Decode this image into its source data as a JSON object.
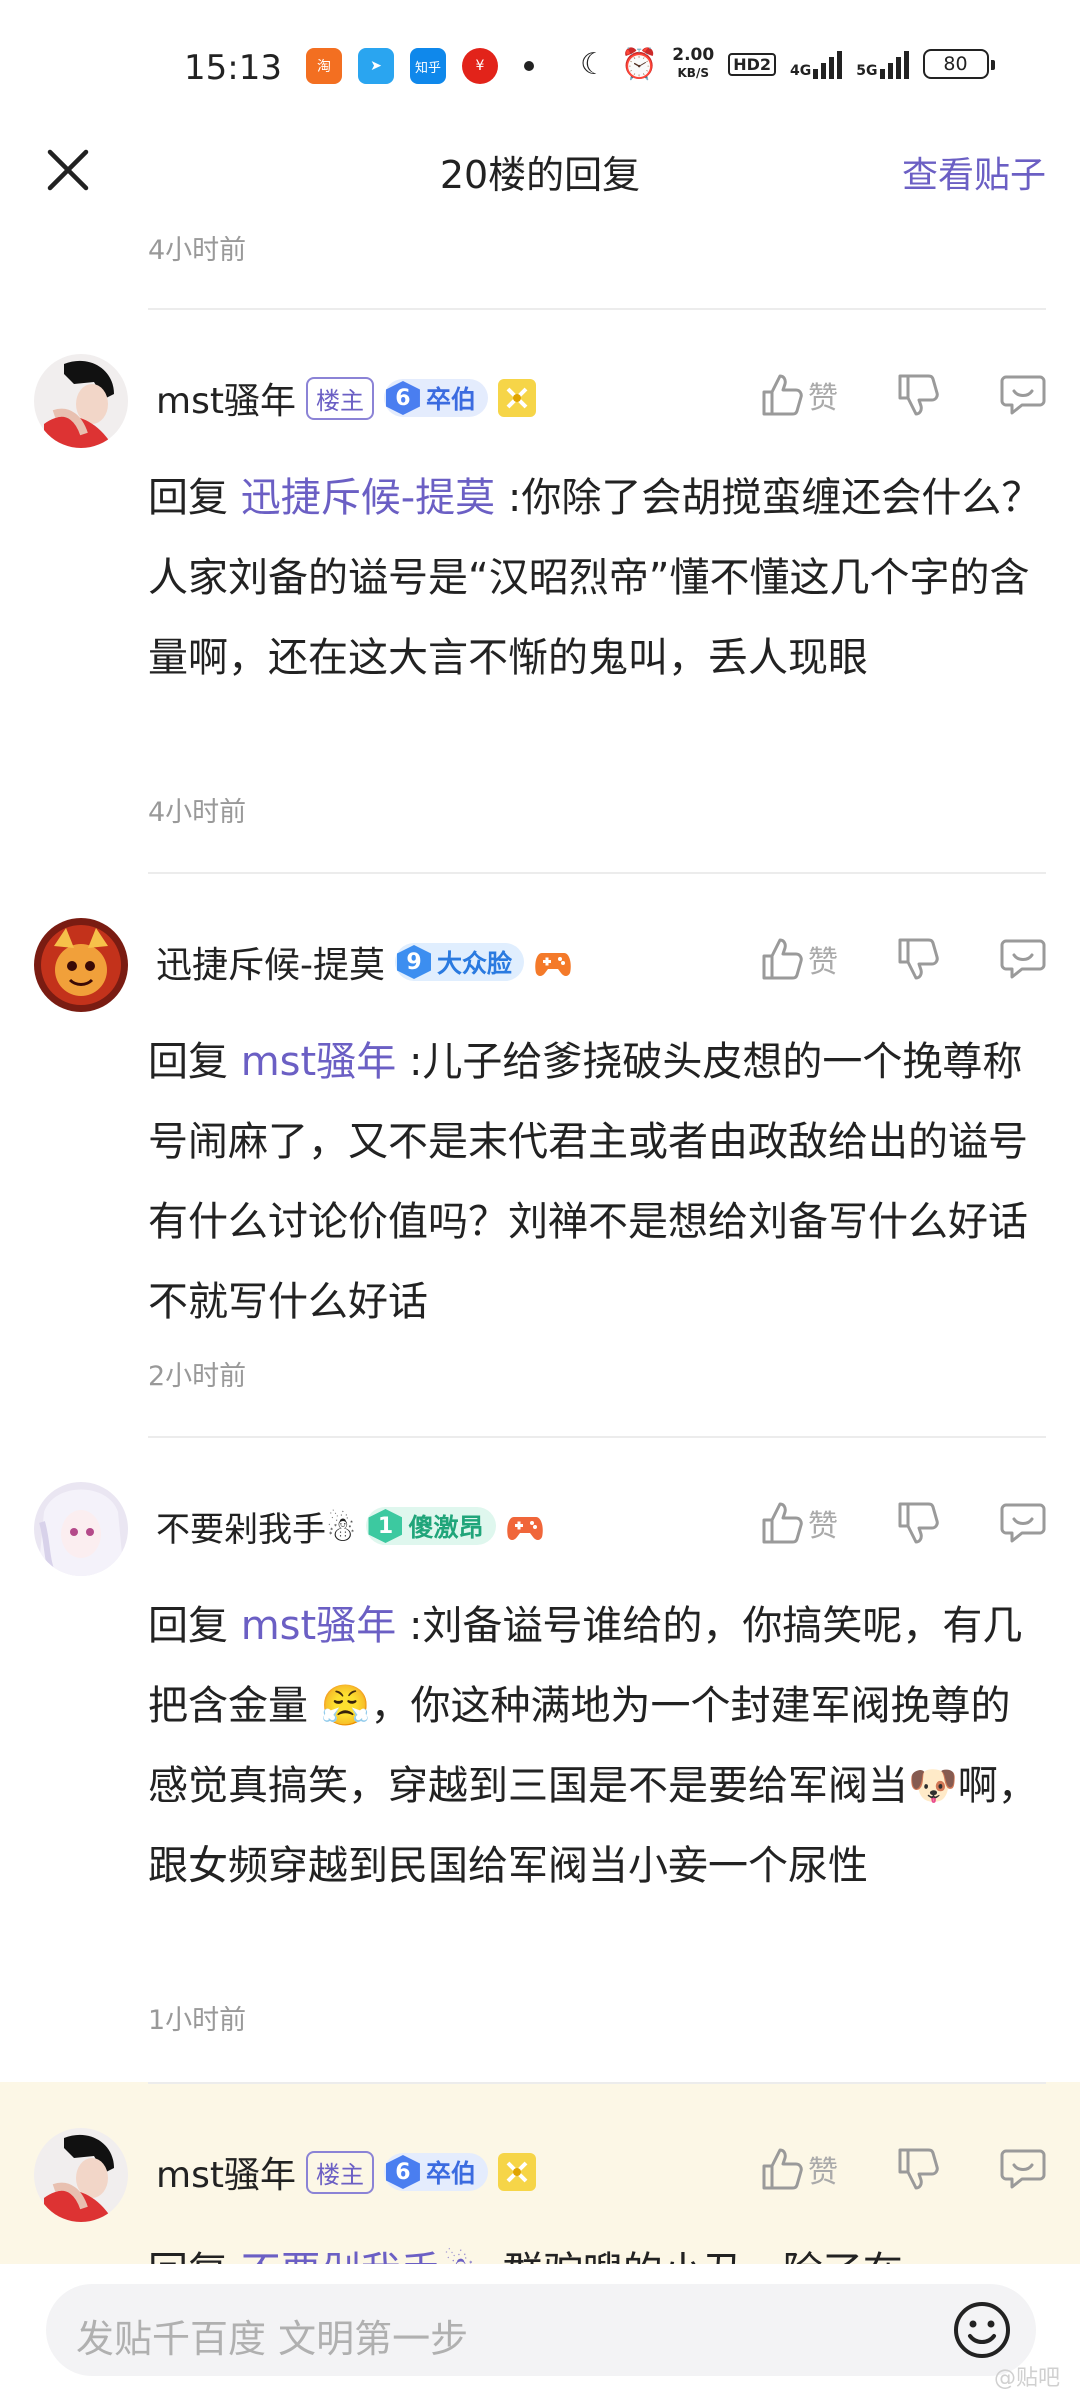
{
  "status_bar": {
    "time": "15:13",
    "speed_top": "2.00",
    "speed_bottom": "KB/S",
    "hd_tag": "HD2",
    "net_4g": "4G",
    "net_5g": "5G",
    "battery": "80",
    "apps": [
      {
        "name": "taobao-app-icon",
        "color": "#f36f21",
        "glyph": "淘"
      },
      {
        "name": "dingtalk-app-icon",
        "color": "#2aa5f0",
        "glyph": "➤"
      },
      {
        "name": "zhihu-app-icon",
        "color": "#0f88eb",
        "glyph": "知乎"
      },
      {
        "name": "ecny-app-icon",
        "color": "#e2231a",
        "glyph": "¥"
      }
    ]
  },
  "nav": {
    "title": "20楼的回复",
    "view_post": "查看贴子"
  },
  "top_time": "4小时前",
  "replies": [
    {
      "user": "mst骚年",
      "is_op": true,
      "op_label": "楼主",
      "level": "6",
      "title": "卒伯",
      "level_color": "#4a7ef0",
      "level_bg": "#e4ecfd",
      "title_color": "#3b6be0",
      "prefix": "回复",
      "mention": "迅捷斥候-提莫",
      "text": ":你除了会胡搅蛮缠还会什么？人家刘备的谥号是“汉昭烈帝”懂不懂这几个字的含量啊，还在这大言不惭的鬼叫，丢人现眼",
      "time": "4小时前",
      "like_label": "赞"
    },
    {
      "user": "迅捷斥候-提莫",
      "is_op": false,
      "level": "9",
      "title": "大众脸",
      "level_color": "#3c8ef0",
      "level_bg": "#e0eefe",
      "title_color": "#2a7ae0",
      "prefix": "回复",
      "mention": "mst骚年",
      "text": ":儿子给爹挠破头皮想的一个挽尊称号闹麻了，又不是末代君主或者由政敌给出的谥号有什么讨论价值吗？刘禅不是想给刘备写什么好话不就写什么好话",
      "time": "2小时前",
      "like_label": "赞"
    },
    {
      "user": "不要剁我手☃",
      "is_op": false,
      "level": "1",
      "title": "傻激昂",
      "level_color": "#3cc9a0",
      "level_bg": "#dff7ee",
      "title_color": "#20a57a",
      "prefix": "回复",
      "mention": "mst骚年",
      "text": ":刘备谥号谁给的，你搞笑呢，有几把含金量 😤，你这种满地为一个封建军阀挽尊的感觉真搞笑，穿越到三国是不是要给军阀当🐶啊，跟女频穿越到民国给军阀当小妾一个尿性",
      "time": "1小时前",
      "like_label": "赞"
    },
    {
      "user": "mst骚年",
      "is_op": true,
      "op_label": "楼主",
      "level": "6",
      "title": "卒伯",
      "level_color": "#4a7ef0",
      "level_bg": "#e4ecfd",
      "title_color": "#3b6be0",
      "prefix": "回复",
      "mention": "不要剁我手☃",
      "text": ":群驼嗖的小丑，除了在",
      "time": "",
      "like_label": "赞"
    }
  ],
  "bottom": {
    "placeholder": "发贴千百度 文明第一步",
    "watermark": "@贴吧"
  }
}
